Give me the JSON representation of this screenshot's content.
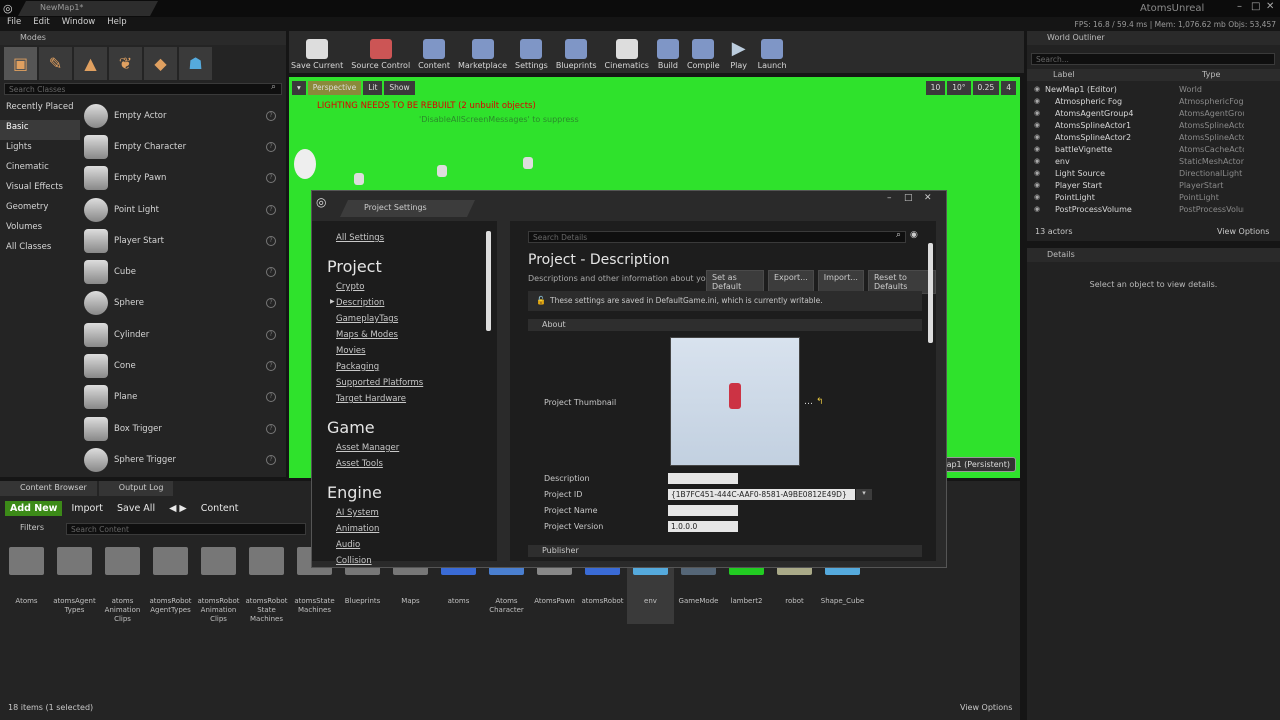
{
  "titlebar": {
    "tab": "NewMap1*",
    "app": "AtomsUnreal"
  },
  "menu": [
    "File",
    "Edit",
    "Window",
    "Help"
  ],
  "stats": {
    "fps": "FPS: 16.8 / 59.4 ms",
    "mem": "Mem: 1,076.62 mb",
    "objs": "Objs: 53,457"
  },
  "modes": {
    "title": "Modes",
    "search_placeholder": "Search Classes",
    "categories": [
      "Recently Placed",
      "Basic",
      "Lights",
      "Cinematic",
      "Visual Effects",
      "Geometry",
      "Volumes",
      "All Classes"
    ],
    "classes": [
      "Empty Actor",
      "Empty Character",
      "Empty Pawn",
      "Point Light",
      "Player Start",
      "Cube",
      "Sphere",
      "Cylinder",
      "Cone",
      "Plane",
      "Box Trigger",
      "Sphere Trigger"
    ]
  },
  "toolbar": [
    "Save Current",
    "Source Control",
    "Content",
    "Marketplace",
    "Settings",
    "Blueprints",
    "Cinematics",
    "Build",
    "Compile",
    "Play",
    "Launch"
  ],
  "viewport": {
    "perspective": "Perspective",
    "lit": "Lit",
    "show": "Show",
    "warning": "LIGHTING NEEDS TO BE REBUILT (2 unbuilt objects)",
    "suppress": "'DisableAllScreenMessages' to suppress",
    "grid": "10",
    "angle": "10°",
    "scale": "0.25",
    "speed": "4",
    "level": "NewMap1 (Persistent)"
  },
  "outliner": {
    "title": "World Outliner",
    "search_placeholder": "Search...",
    "col_label": "Label",
    "col_type": "Type",
    "rows": [
      [
        "NewMap1 (Editor)",
        "World"
      ],
      [
        "Atmospheric Fog",
        "AtmosphericFog"
      ],
      [
        "AtomsAgentGroup4",
        "AtomsAgentGroup"
      ],
      [
        "AtomsSplineActor1",
        "AtomsSplineActor"
      ],
      [
        "AtomsSplineActor2",
        "AtomsSplineActor"
      ],
      [
        "battleVignette",
        "AtomsCacheActor"
      ],
      [
        "env",
        "StaticMeshActor"
      ],
      [
        "Light Source",
        "DirectionalLight"
      ],
      [
        "Player Start",
        "PlayerStart"
      ],
      [
        "PointLight",
        "PointLight"
      ],
      [
        "PostProcessVolume",
        "PostProcessVolume"
      ]
    ],
    "count": "13 actors",
    "view_options": "View Options"
  },
  "details": {
    "title": "Details",
    "empty": "Select an object to view details."
  },
  "content_browser": {
    "tab1": "Content Browser",
    "tab2": "Output Log",
    "add_new": "Add New",
    "import": "Import",
    "save_all": "Save All",
    "path": "Content",
    "filters": "Filters",
    "search_placeholder": "Search Content",
    "assets": [
      "Atoms",
      "atomsAgent Types",
      "atoms Animation Clips",
      "atomsRobot AgentTypes",
      "atomsRobot Animation Clips",
      "atomsRobot State Machines",
      "atomsState Machines",
      "Blueprints",
      "Maps",
      "atoms",
      "Atoms Character",
      "AtomsPawn",
      "atomsRobot",
      "env",
      "GameMode",
      "lambert2",
      "robot",
      "Shape_Cube"
    ],
    "status": "18 items (1 selected)",
    "view_options": "View Options"
  },
  "dialog": {
    "tab": "Project Settings",
    "search_placeholder": "Search Details",
    "all_settings": "All Settings",
    "sections": [
      {
        "h": "Project",
        "items": [
          "Crypto",
          "Description",
          "GameplayTags",
          "Maps & Modes",
          "Movies",
          "Packaging",
          "Supported Platforms",
          "Target Hardware"
        ]
      },
      {
        "h": "Game",
        "items": [
          "Asset Manager",
          "Asset Tools"
        ]
      },
      {
        "h": "Engine",
        "items": [
          "AI System",
          "Animation",
          "Audio",
          "Collision"
        ]
      }
    ],
    "heading": "Project - Description",
    "subheading": "Descriptions and other information about your",
    "buttons": [
      "Set as Default",
      "Export...",
      "Import...",
      "Reset to Defaults"
    ],
    "notice": "These settings are saved in DefaultGame.ini, which is currently writable.",
    "about": "About",
    "thumb_label": "Project Thumbnail",
    "fields": [
      [
        "Description",
        ""
      ],
      [
        "Project ID",
        "{1B7FC451-444C-AAF0-8581-A9BE0812E49D}"
      ],
      [
        "Project Name",
        ""
      ],
      [
        "Project Version",
        "1.0.0.0"
      ]
    ],
    "publisher": "Publisher"
  }
}
